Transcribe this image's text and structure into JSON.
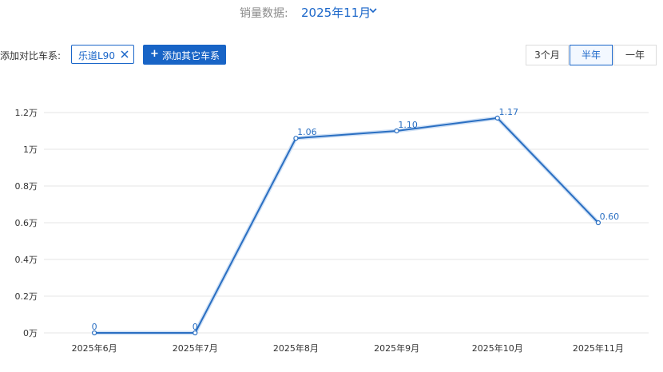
{
  "header": {
    "label": "销量数据:",
    "month": "2025年11月"
  },
  "compare": {
    "label": "添加对比车系:",
    "tag": "乐道L90",
    "add_button": "添加其它车系"
  },
  "ranges": [
    {
      "label": "3个月",
      "active": false
    },
    {
      "label": "半年",
      "active": true
    },
    {
      "label": "一年",
      "active": false
    }
  ],
  "colors": {
    "accent": "#1a66c9",
    "line": "#2a6fc2",
    "grid": "#e6e6e6"
  },
  "chart_data": {
    "type": "line",
    "categories": [
      "2025年6月",
      "2025年7月",
      "2025年8月",
      "2025年9月",
      "2025年10月",
      "2025年11月"
    ],
    "series": [
      {
        "values": [
          0,
          0,
          1.06,
          1.1,
          1.17,
          0.6
        ],
        "labels": [
          "0",
          "0",
          "1.06",
          "1.10",
          "1.17",
          "0.60"
        ]
      }
    ],
    "yticks": [
      "0万",
      "0.2万",
      "0.4万",
      "0.6万",
      "0.8万",
      "1万",
      "1.2万"
    ],
    "ylim": [
      0,
      1.2
    ],
    "grid": true
  }
}
